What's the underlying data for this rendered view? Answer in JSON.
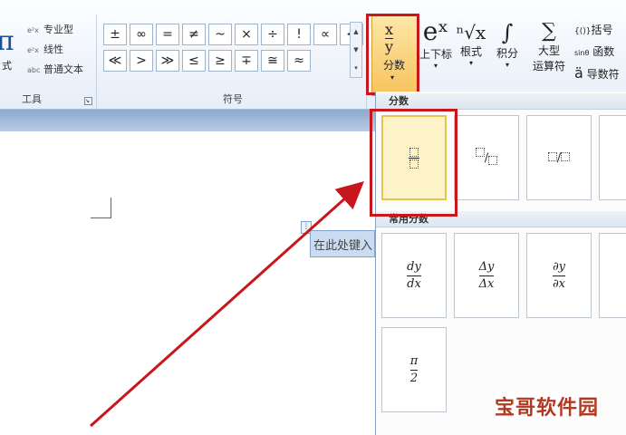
{
  "ribbon": {
    "tools": {
      "big_glyph": "π",
      "fragment": "式",
      "items": [
        {
          "icon": "e²x",
          "label": "专业型"
        },
        {
          "icon": "e²x",
          "label": "线性"
        },
        {
          "icon": "abc",
          "label": "普通文本"
        }
      ],
      "group_label": "工具"
    },
    "symbols": {
      "items": [
        "±",
        "∞",
        "=",
        "≠",
        "~",
        "×",
        "÷",
        "!",
        "∝",
        "<",
        "≪",
        ">",
        "≫",
        "≤",
        "≥",
        "∓",
        "≅",
        "≈"
      ],
      "group_label": "符号"
    },
    "structures": {
      "fraction": {
        "top": "x",
        "bottom": "y",
        "label": "分数"
      },
      "script": {
        "glyph": "eˣ",
        "label": "上下标"
      },
      "radical": {
        "glyph": "ⁿ√x",
        "label": "根式"
      },
      "integral": {
        "glyph": "∫",
        "label": "积分"
      },
      "nary": {
        "glyph": "∑",
        "label_line1": "大型",
        "label_line2": "运算符"
      },
      "bracket": {
        "icon": "{()}",
        "label": "括号"
      },
      "function": {
        "icon": "sinθ",
        "label": "函数"
      },
      "accent": {
        "icon": "ä",
        "label": "导数符"
      }
    }
  },
  "document": {
    "equation_placeholder": "在此处键入"
  },
  "gallery": {
    "section1": "分数",
    "section2": "常用分数",
    "common": [
      {
        "num": "dy",
        "den": "dx"
      },
      {
        "num": "Δy",
        "den": "Δx"
      },
      {
        "num": "∂y",
        "den": "∂x"
      },
      {
        "num": "π",
        "den": "2"
      }
    ]
  },
  "watermark": "宝哥软件园"
}
